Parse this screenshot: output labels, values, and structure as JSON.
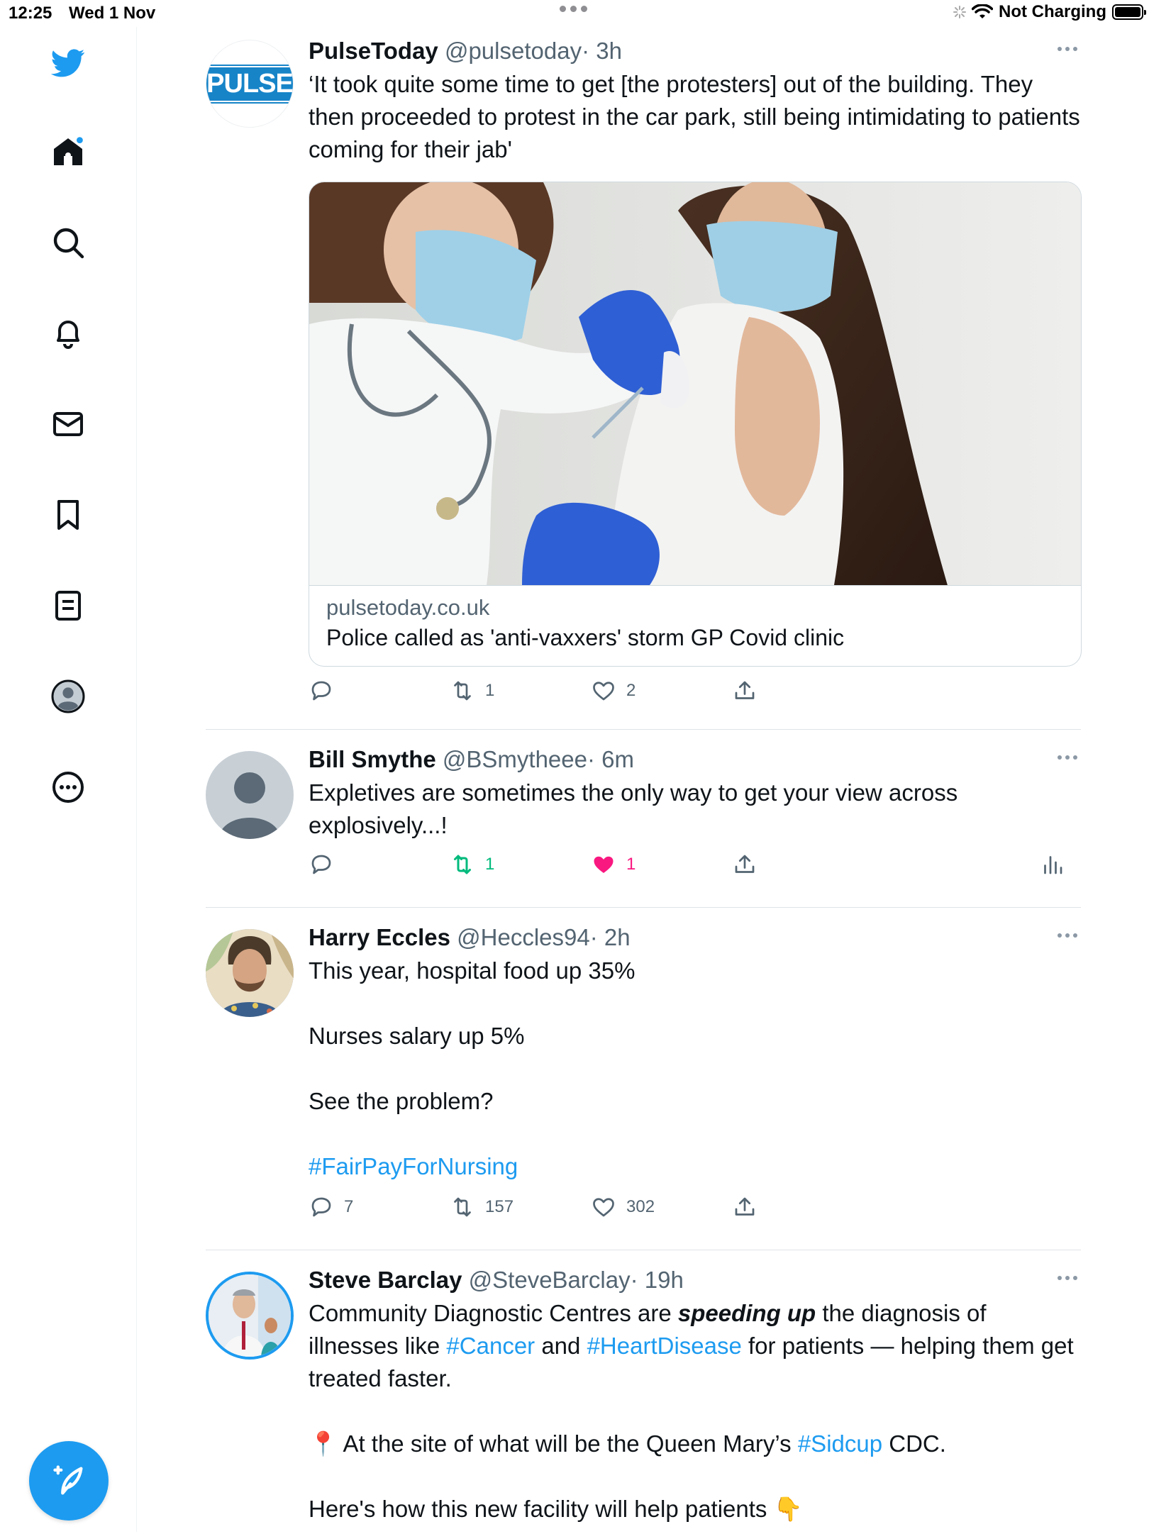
{
  "status_bar": {
    "time": "12:25",
    "date": "Wed 1 Nov",
    "charging": "Not Charging"
  },
  "sidebar": {
    "items": [
      {
        "icon": "twitter-bird-icon"
      },
      {
        "icon": "home-icon"
      },
      {
        "icon": "search-icon"
      },
      {
        "icon": "bell-icon"
      },
      {
        "icon": "mail-icon"
      },
      {
        "icon": "bookmark-icon"
      },
      {
        "icon": "lists-icon"
      },
      {
        "icon": "profile-icon"
      },
      {
        "icon": "more-circle-icon"
      }
    ],
    "compose_icon": "compose-feather-icon",
    "accent": "#1d9bf0"
  },
  "tweets": [
    {
      "name": "PulseToday",
      "handle": "@pulsetoday",
      "time": "· 3h",
      "avatar_text": "PULSE",
      "text": "‘It took quite some time to get [the protesters] out of the building. They then proceeded to protest in the car park, still being intimidating to patients coming for their jab'",
      "card": {
        "domain": "pulsetoday.co.uk",
        "title": "Police called as 'anti-vaxxers' storm GP Covid clinic"
      },
      "replies": "",
      "retweets": "1",
      "likes": "2"
    },
    {
      "name": "Bill Smythe",
      "handle": "@BSmytheee",
      "time": "· 6m",
      "text": "Expletives are sometimes the only way to get your view across explosively...!",
      "replies": "",
      "retweets": "1",
      "likes": "1",
      "retweet_color": "#00ba7c",
      "like_color": "#f91880"
    },
    {
      "name": "Harry Eccles",
      "handle": "@Heccles94",
      "time": "· 2h",
      "text_lines": [
        "This year, hospital food up 35%",
        "Nurses salary up 5%",
        "See the problem?"
      ],
      "hashtag": "#FairPayForNursing",
      "replies": "7",
      "retweets": "157",
      "likes": "302"
    },
    {
      "name": "Steve Barclay",
      "handle": "@SteveBarclay",
      "time": "· 19h",
      "text_p1_a": "Community Diagnostic Centres are ",
      "text_p1_em": "speeding up",
      "text_p1_b": " the diagnosis of illnesses like ",
      "tag_cancer": "#Cancer",
      "text_p1_c": " and ",
      "tag_heart": "#HeartDisease",
      "text_p1_d": " for patients — helping them get treated faster.",
      "pin": "📍",
      "text_p2_a": " At the site of what will be the Queen Mary’s ",
      "tag_sidcup": "#Sidcup",
      "text_p2_b": " CDC.",
      "text_p3": "Here's how this new facility will help patients ",
      "point_down": "👇"
    }
  ]
}
